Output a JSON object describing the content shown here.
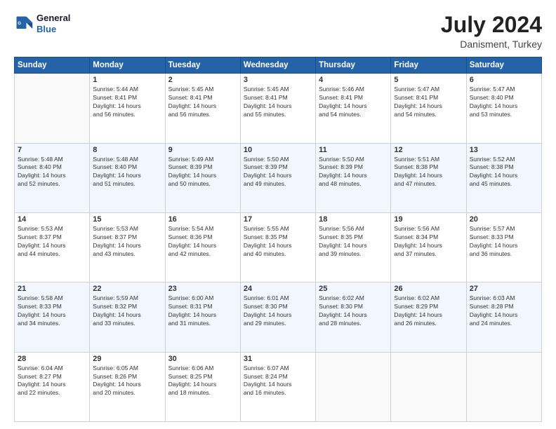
{
  "logo": {
    "line1": "General",
    "line2": "Blue"
  },
  "title": "July 2024",
  "subtitle": "Danisment, Turkey",
  "weekdays": [
    "Sunday",
    "Monday",
    "Tuesday",
    "Wednesday",
    "Thursday",
    "Friday",
    "Saturday"
  ],
  "weeks": [
    [
      {
        "day": "",
        "info": ""
      },
      {
        "day": "1",
        "info": "Sunrise: 5:44 AM\nSunset: 8:41 PM\nDaylight: 14 hours\nand 56 minutes."
      },
      {
        "day": "2",
        "info": "Sunrise: 5:45 AM\nSunset: 8:41 PM\nDaylight: 14 hours\nand 56 minutes."
      },
      {
        "day": "3",
        "info": "Sunrise: 5:45 AM\nSunset: 8:41 PM\nDaylight: 14 hours\nand 55 minutes."
      },
      {
        "day": "4",
        "info": "Sunrise: 5:46 AM\nSunset: 8:41 PM\nDaylight: 14 hours\nand 54 minutes."
      },
      {
        "day": "5",
        "info": "Sunrise: 5:47 AM\nSunset: 8:41 PM\nDaylight: 14 hours\nand 54 minutes."
      },
      {
        "day": "6",
        "info": "Sunrise: 5:47 AM\nSunset: 8:40 PM\nDaylight: 14 hours\nand 53 minutes."
      }
    ],
    [
      {
        "day": "7",
        "info": "Sunrise: 5:48 AM\nSunset: 8:40 PM\nDaylight: 14 hours\nand 52 minutes."
      },
      {
        "day": "8",
        "info": "Sunrise: 5:48 AM\nSunset: 8:40 PM\nDaylight: 14 hours\nand 51 minutes."
      },
      {
        "day": "9",
        "info": "Sunrise: 5:49 AM\nSunset: 8:39 PM\nDaylight: 14 hours\nand 50 minutes."
      },
      {
        "day": "10",
        "info": "Sunrise: 5:50 AM\nSunset: 8:39 PM\nDaylight: 14 hours\nand 49 minutes."
      },
      {
        "day": "11",
        "info": "Sunrise: 5:50 AM\nSunset: 8:39 PM\nDaylight: 14 hours\nand 48 minutes."
      },
      {
        "day": "12",
        "info": "Sunrise: 5:51 AM\nSunset: 8:38 PM\nDaylight: 14 hours\nand 47 minutes."
      },
      {
        "day": "13",
        "info": "Sunrise: 5:52 AM\nSunset: 8:38 PM\nDaylight: 14 hours\nand 45 minutes."
      }
    ],
    [
      {
        "day": "14",
        "info": "Sunrise: 5:53 AM\nSunset: 8:37 PM\nDaylight: 14 hours\nand 44 minutes."
      },
      {
        "day": "15",
        "info": "Sunrise: 5:53 AM\nSunset: 8:37 PM\nDaylight: 14 hours\nand 43 minutes."
      },
      {
        "day": "16",
        "info": "Sunrise: 5:54 AM\nSunset: 8:36 PM\nDaylight: 14 hours\nand 42 minutes."
      },
      {
        "day": "17",
        "info": "Sunrise: 5:55 AM\nSunset: 8:35 PM\nDaylight: 14 hours\nand 40 minutes."
      },
      {
        "day": "18",
        "info": "Sunrise: 5:56 AM\nSunset: 8:35 PM\nDaylight: 14 hours\nand 39 minutes."
      },
      {
        "day": "19",
        "info": "Sunrise: 5:56 AM\nSunset: 8:34 PM\nDaylight: 14 hours\nand 37 minutes."
      },
      {
        "day": "20",
        "info": "Sunrise: 5:57 AM\nSunset: 8:33 PM\nDaylight: 14 hours\nand 36 minutes."
      }
    ],
    [
      {
        "day": "21",
        "info": "Sunrise: 5:58 AM\nSunset: 8:33 PM\nDaylight: 14 hours\nand 34 minutes."
      },
      {
        "day": "22",
        "info": "Sunrise: 5:59 AM\nSunset: 8:32 PM\nDaylight: 14 hours\nand 33 minutes."
      },
      {
        "day": "23",
        "info": "Sunrise: 6:00 AM\nSunset: 8:31 PM\nDaylight: 14 hours\nand 31 minutes."
      },
      {
        "day": "24",
        "info": "Sunrise: 6:01 AM\nSunset: 8:30 PM\nDaylight: 14 hours\nand 29 minutes."
      },
      {
        "day": "25",
        "info": "Sunrise: 6:02 AM\nSunset: 8:30 PM\nDaylight: 14 hours\nand 28 minutes."
      },
      {
        "day": "26",
        "info": "Sunrise: 6:02 AM\nSunset: 8:29 PM\nDaylight: 14 hours\nand 26 minutes."
      },
      {
        "day": "27",
        "info": "Sunrise: 6:03 AM\nSunset: 8:28 PM\nDaylight: 14 hours\nand 24 minutes."
      }
    ],
    [
      {
        "day": "28",
        "info": "Sunrise: 6:04 AM\nSunset: 8:27 PM\nDaylight: 14 hours\nand 22 minutes."
      },
      {
        "day": "29",
        "info": "Sunrise: 6:05 AM\nSunset: 8:26 PM\nDaylight: 14 hours\nand 20 minutes."
      },
      {
        "day": "30",
        "info": "Sunrise: 6:06 AM\nSunset: 8:25 PM\nDaylight: 14 hours\nand 18 minutes."
      },
      {
        "day": "31",
        "info": "Sunrise: 6:07 AM\nSunset: 8:24 PM\nDaylight: 14 hours\nand 16 minutes."
      },
      {
        "day": "",
        "info": ""
      },
      {
        "day": "",
        "info": ""
      },
      {
        "day": "",
        "info": ""
      }
    ]
  ]
}
